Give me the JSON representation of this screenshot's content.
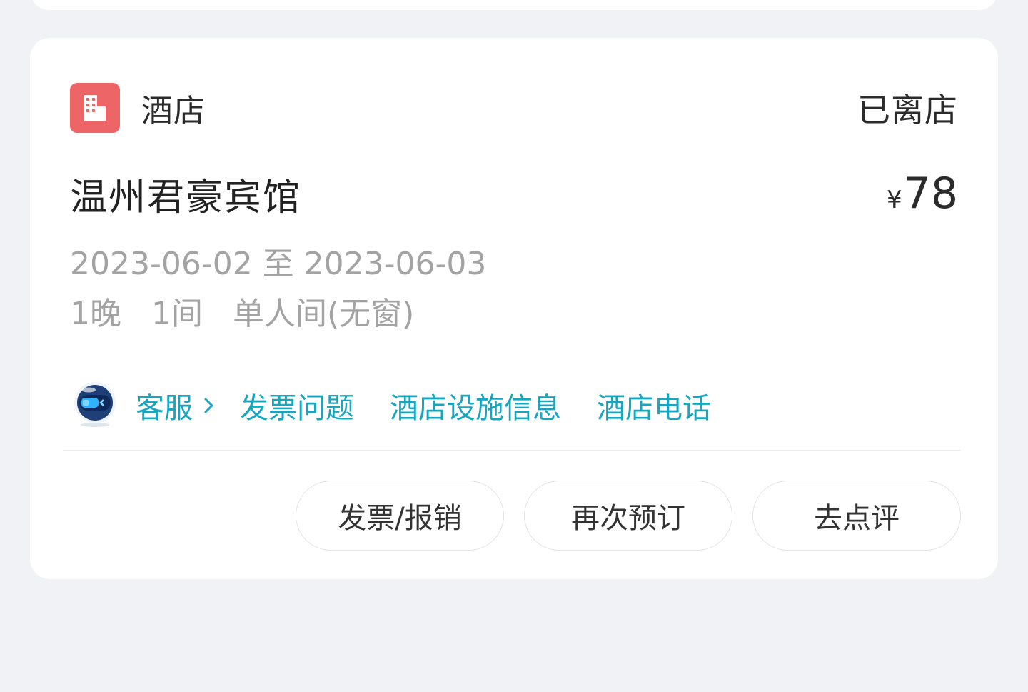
{
  "order": {
    "category": "酒店",
    "category_icon": "hotel-building-icon",
    "status": "已离店",
    "hotel_name": "温州君豪宾馆",
    "currency": "¥",
    "price": "78",
    "dates": "2023-06-02 至 2023-06-03",
    "nights": "1晚",
    "rooms": "1间",
    "room_type": "单人间(无窗)"
  },
  "links": {
    "service_label": "客服",
    "service_icon": "robot-avatar-icon",
    "invoice_issue": "发票问题",
    "facilities": "酒店设施信息",
    "phone": "酒店电话"
  },
  "actions": {
    "invoice": "发票/报销",
    "rebook": "再次预订",
    "review": "去点评"
  },
  "colors": {
    "accent": "#16a6bf",
    "hotel_icon_bg": "#ed6566",
    "page_bg": "#f1f2f6"
  }
}
